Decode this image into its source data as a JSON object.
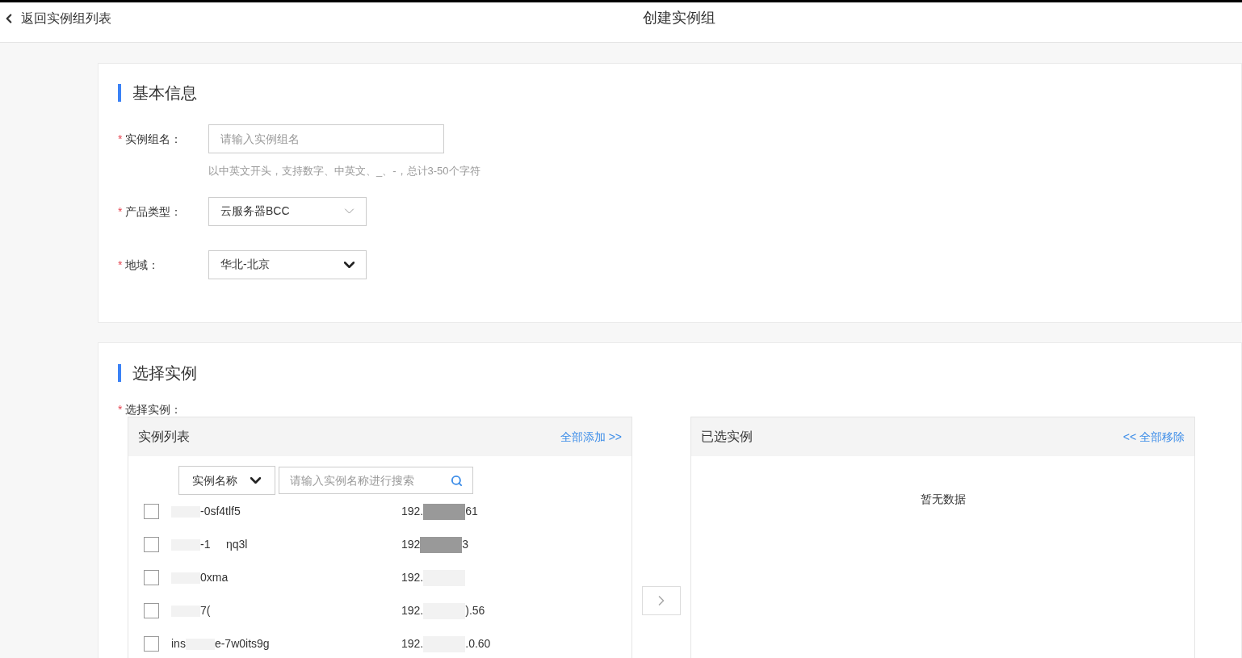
{
  "header": {
    "back_link": "返回实例组列表",
    "title": "创建实例组"
  },
  "basic_info": {
    "heading": "基本信息",
    "fields": [
      {
        "kind": "input",
        "label": "实例组名：",
        "required_mark": "*",
        "placeholder": "请输入实例组名",
        "hint": "以中英文开头，支持数字、中英文、_、-，总计3-50个字符"
      },
      {
        "kind": "select",
        "label": "产品类型：",
        "required_mark": "*",
        "value": "云服务器BCC"
      },
      {
        "kind": "dropdown",
        "label": "地域：",
        "required_mark": "*",
        "value": "华北-北京"
      }
    ]
  },
  "select_instances": {
    "heading": "选择实例",
    "label": "选择实例：",
    "required_mark": "*",
    "instance_list": {
      "title": "实例列表",
      "add_all": "全部添加 >>",
      "filter": "实例名称",
      "search_placeholder": "请输入实例名称进行搜索",
      "rows": [
        {
          "name_end": "-0sf4tlf5",
          "ip_start": "192.",
          "ip_end": "61",
          "checked": false
        },
        {
          "name_end": "-1     ηq3l",
          "ip_start": "192",
          "ip_end": "3",
          "checked": false
        },
        {
          "name_end": "0xma",
          "ip_start": "192.",
          "checked": false
        },
        {
          "name_end": "7(",
          "ip_start": "192.",
          "ip_end": ").56",
          "checked": false
        },
        {
          "name_start": "ins",
          "name_end": "e-7w0its9g",
          "ip_start": "192.",
          "ip_end": ".0.60",
          "checked": false
        }
      ]
    },
    "selected": {
      "title": "已选实例",
      "remove_all": "<< 全部移除",
      "empty": "暂无数据"
    }
  }
}
